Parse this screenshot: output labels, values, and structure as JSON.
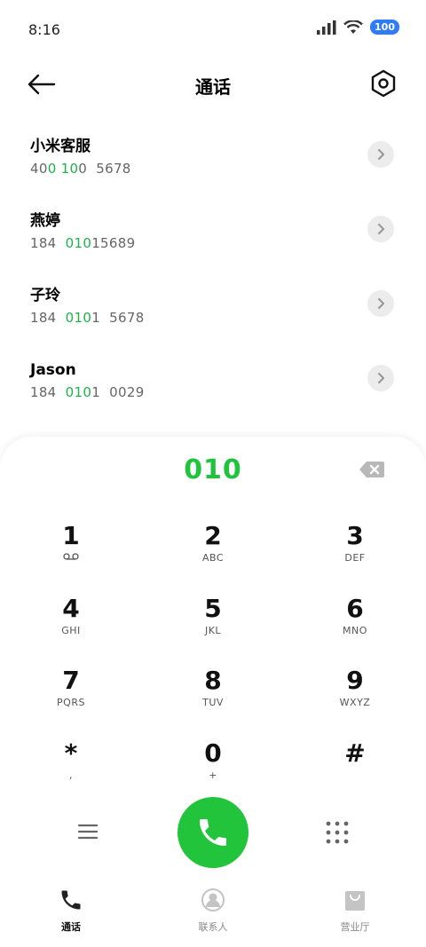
{
  "status": {
    "time": "8:16",
    "battery": "100"
  },
  "header": {
    "title": "通话"
  },
  "contacts": [
    {
      "name": "小米客服",
      "number_parts": [
        {
          "t": "40",
          "h": false
        },
        {
          "t": "0",
          "h": true
        },
        {
          "t": " ",
          "h": false
        },
        {
          "t": "10",
          "h": true
        },
        {
          "t": "0  5678",
          "h": false
        }
      ]
    },
    {
      "name": "燕婷",
      "number_parts": [
        {
          "t": "184  ",
          "h": false
        },
        {
          "t": "010",
          "h": true
        },
        {
          "t": "15689",
          "h": false
        }
      ]
    },
    {
      "name": "子玲",
      "number_parts": [
        {
          "t": "184  ",
          "h": false
        },
        {
          "t": "010",
          "h": true
        },
        {
          "t": "1  5678",
          "h": false
        }
      ]
    },
    {
      "name": "Jason",
      "number_parts": [
        {
          "t": "184  ",
          "h": false
        },
        {
          "t": "010",
          "h": true
        },
        {
          "t": "1  0029",
          "h": false
        }
      ]
    }
  ],
  "dialer": {
    "number": "010"
  },
  "keypad": [
    [
      {
        "digit": "1",
        "letters": "voicemail"
      },
      {
        "digit": "2",
        "letters": "ABC"
      },
      {
        "digit": "3",
        "letters": "DEF"
      }
    ],
    [
      {
        "digit": "4",
        "letters": "GHI"
      },
      {
        "digit": "5",
        "letters": "JKL"
      },
      {
        "digit": "6",
        "letters": "MNO"
      }
    ],
    [
      {
        "digit": "7",
        "letters": "PQRS"
      },
      {
        "digit": "8",
        "letters": "TUV"
      },
      {
        "digit": "9",
        "letters": "WXYZ"
      }
    ],
    [
      {
        "digit": "*",
        "letters": ","
      },
      {
        "digit": "0",
        "letters": "+"
      },
      {
        "digit": "#",
        "letters": ""
      }
    ]
  ],
  "tabs": [
    {
      "label": "通话",
      "icon": "phone-icon",
      "active": true
    },
    {
      "label": "联系人",
      "icon": "person-icon",
      "active": false
    },
    {
      "label": "营业厅",
      "icon": "shopping-bag-icon",
      "active": false
    }
  ],
  "colors": {
    "accent_green": "#22c43b",
    "highlight_green": "#1fb04a",
    "battery_blue": "#2f7cf6"
  }
}
